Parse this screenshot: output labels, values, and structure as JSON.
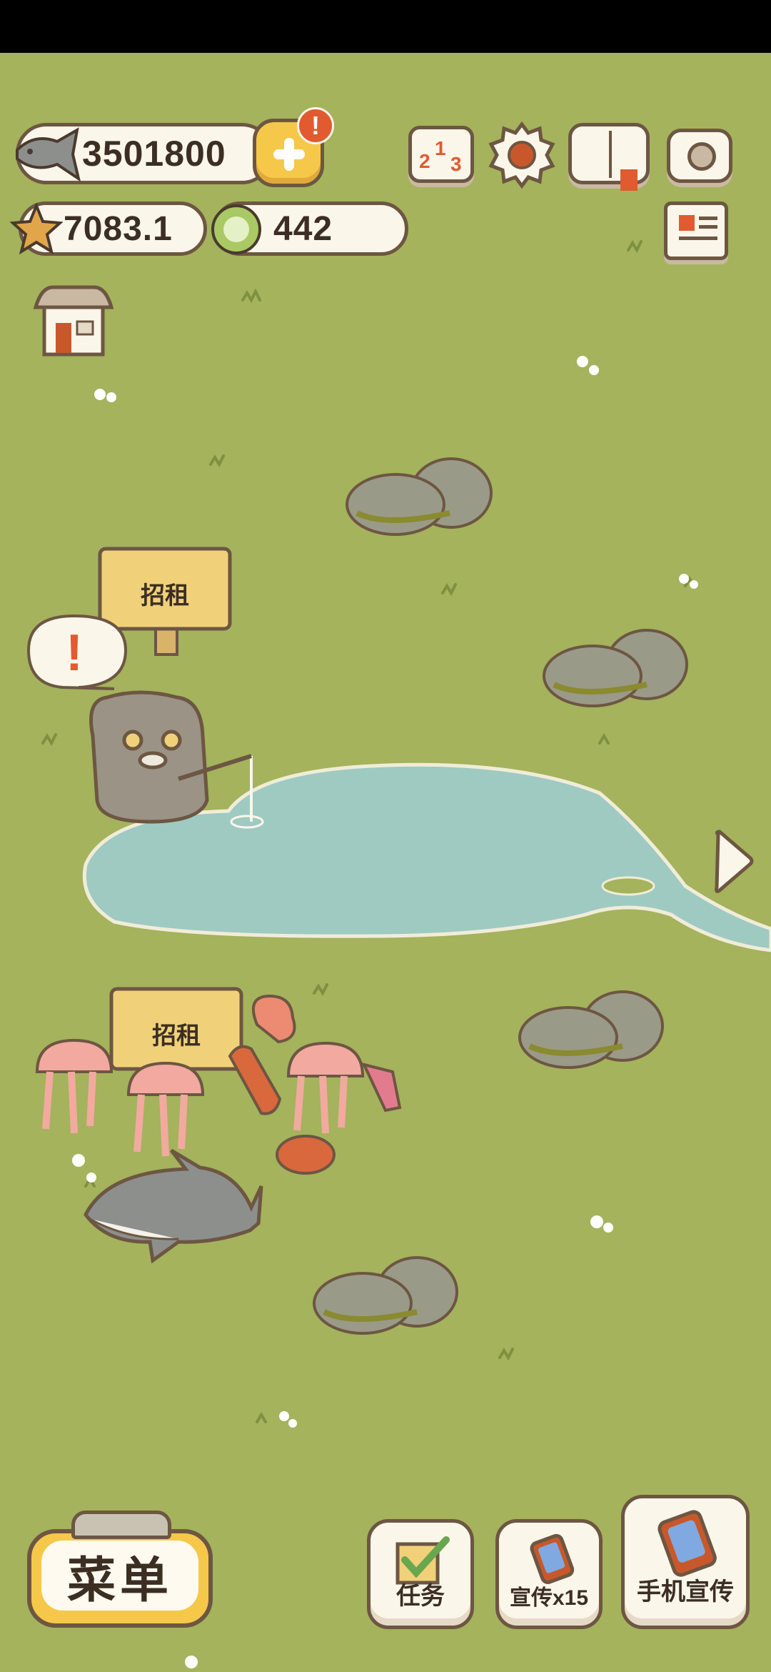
{
  "hud": {
    "fish_count": "3501800",
    "plus_alert": "!",
    "star_value": "7083.1",
    "gem_value": "442"
  },
  "scene": {
    "sign_upper": "招租",
    "sign_lower": "招租",
    "speech_alert": "!"
  },
  "bottom": {
    "menu_label": "菜单",
    "tasks_label": "任务",
    "promote_label": "宣传x15",
    "phone_promote_label": "手机宣传"
  },
  "icons": {
    "top_row": [
      "ranking-icon",
      "settings-gear-icon",
      "guide-book-icon",
      "camera-icon"
    ],
    "second_row": [
      "newspaper-icon"
    ],
    "left": [
      "shop-icon"
    ]
  },
  "colors": {
    "grass": "#a4b35c",
    "pond": "#9ecac2",
    "outline": "#6d5642",
    "accent": "#f6c84a"
  }
}
